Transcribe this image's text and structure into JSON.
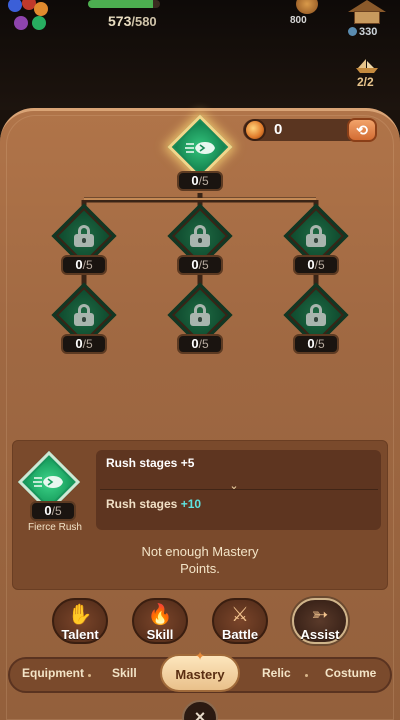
{
  "header": {
    "hp_current": "573",
    "hp_max": "/580",
    "hp_fill_fraction": 0.9,
    "gold": "800",
    "coins": "330",
    "ship_count": "2/2"
  },
  "points": {
    "value": "0"
  },
  "main_node": {
    "level": "0",
    "max": "/5"
  },
  "nodes": [
    {
      "level": "0",
      "max": "/5"
    },
    {
      "level": "0",
      "max": "/5"
    },
    {
      "level": "0",
      "max": "/5"
    },
    {
      "level": "0",
      "max": "/5"
    },
    {
      "level": "0",
      "max": "/5"
    },
    {
      "level": "0",
      "max": "/5"
    }
  ],
  "detail": {
    "level": "0",
    "max": "/5",
    "name": "Fierce Rush",
    "stat1_label": "Rush stages ",
    "stat1_value": "+5",
    "stat2_label": "Rush stages ",
    "stat2_value": "+10",
    "notice": "Not enough Mastery Points."
  },
  "categories": {
    "talent": "Talent",
    "skill": "Skill",
    "battle": "Battle",
    "assist": "Assist"
  },
  "tabs": {
    "equipment": "Equipment",
    "skill": "Skill",
    "mastery": "Mastery",
    "relic": "Relic",
    "costume": "Costume"
  },
  "icons": {
    "close": "×",
    "reset": "⟲",
    "chevron": "⌄"
  }
}
